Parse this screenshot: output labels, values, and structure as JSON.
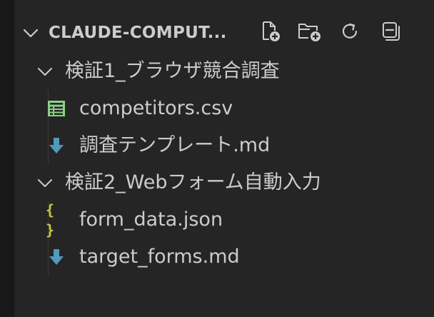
{
  "explorer": {
    "section_title": "CLAUDE-COMPUT...",
    "toolbar": {
      "new_file": "new-file-icon",
      "new_folder": "new-folder-icon",
      "refresh": "refresh-icon",
      "collapse_all": "collapse-all-icon"
    },
    "folders": [
      {
        "name": "検証1_ブラウザ競合調査",
        "files": [
          {
            "name": "competitors.csv",
            "icon": "csv-table-icon"
          },
          {
            "name": "調査テンプレート.md",
            "icon": "markdown-arrow-icon"
          }
        ]
      },
      {
        "name": "検証2_Webフォーム自動入力",
        "files": [
          {
            "name": "form_data.json",
            "icon": "json-braces-icon",
            "icon_text": "{ }"
          },
          {
            "name": "target_forms.md",
            "icon": "markdown-arrow-icon"
          }
        ]
      }
    ]
  },
  "colors": {
    "background": "#252526",
    "gutter": "#181818",
    "text": "#cccccc",
    "csv_icon": "#89d185",
    "markdown_icon": "#519aba",
    "json_icon": "#cbcb41"
  }
}
